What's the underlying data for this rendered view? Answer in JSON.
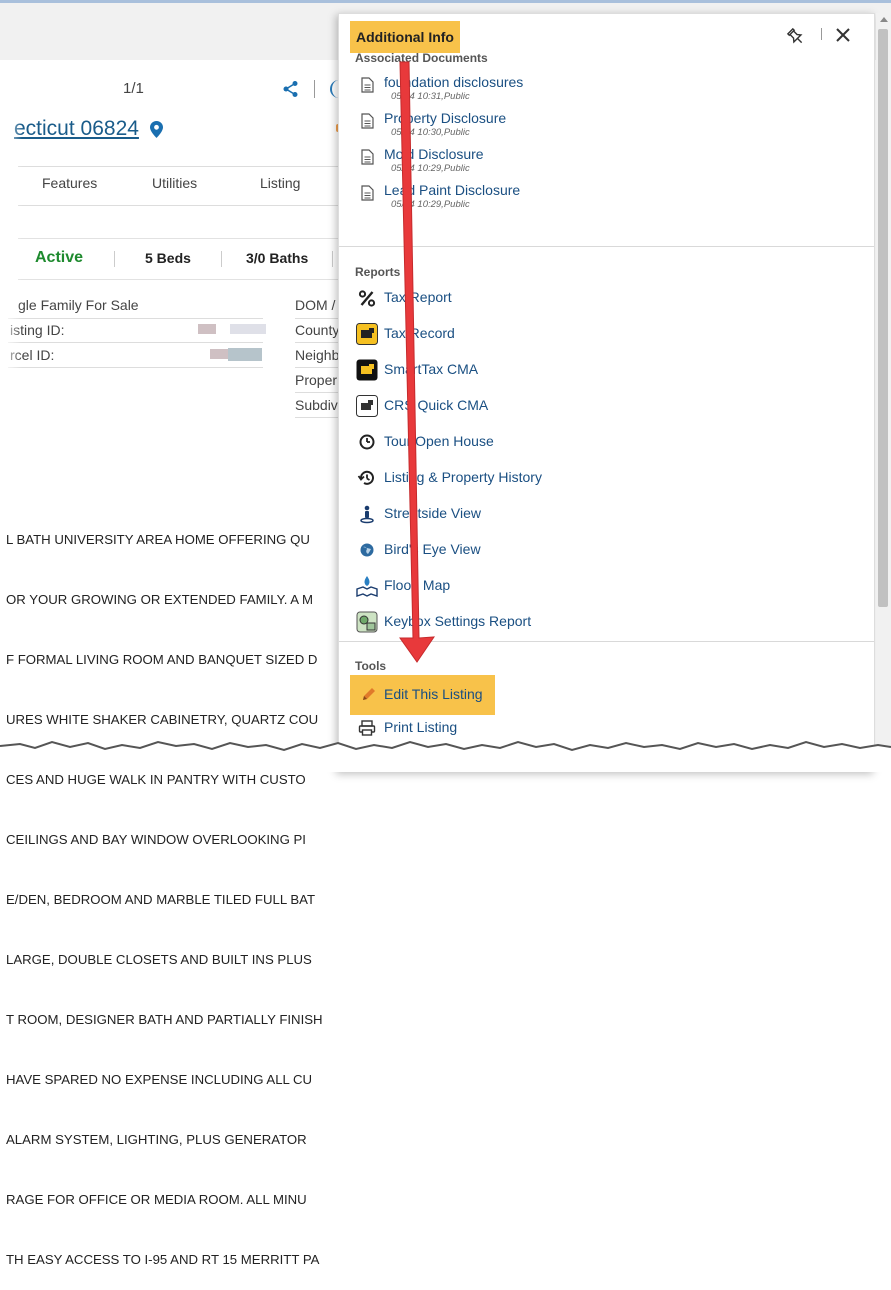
{
  "listing": {
    "page_count": "1/1",
    "address": "ecticut 06824",
    "tabs": [
      "Features",
      "Utilities",
      "Listing"
    ],
    "stats": {
      "status": "Active",
      "beds": "5 Beds",
      "baths": "3/0 Baths"
    },
    "left_details": [
      "gle Family For Sale",
      "isting ID:",
      "rcel ID:"
    ],
    "right_details": [
      "DOM /",
      "County",
      "Neighb",
      "Proper",
      "Subdiv"
    ],
    "description_lines": [
      "L BATH UNIVERSITY AREA HOME OFFERING QU",
      "OR YOUR GROWING OR EXTENDED FAMILY. A M",
      "F FORMAL LIVING ROOM AND BANQUET SIZED D",
      "URES WHITE SHAKER CABINETRY, QUARTZ COU",
      "CES AND HUGE WALK IN PANTRY WITH CUSTO",
      "CEILINGS AND BAY WINDOW OVERLOOKING PI",
      "E/DEN, BEDROOM AND MARBLE TILED FULL BAT",
      "LARGE, DOUBLE CLOSETS AND BUILT INS PLUS",
      "T ROOM, DESIGNER BATH AND PARTIALLY FINISH",
      "HAVE SPARED NO EXPENSE INCLUDING ALL CU",
      "ALARM SYSTEM, LIGHTING, PLUS GENERATOR",
      "RAGE FOR OFFICE OR MEDIA ROOM. ALL MINU",
      "TH EASY ACCESS TO I-95 AND RT 15 MERRITT PA"
    ]
  },
  "panel": {
    "title": "Additional Info",
    "sections": {
      "documents": "Associated Documents",
      "reports": "Reports",
      "tools": "Tools"
    },
    "documents": [
      {
        "label": "foundation disclosures",
        "meta": "05/24 10:31,Public"
      },
      {
        "label": "Property Disclosure",
        "meta": "05/24 10:30,Public"
      },
      {
        "label": "Mold Disclosure",
        "meta": "05/24 10:29,Public"
      },
      {
        "label": "Lead Paint Disclosure",
        "meta": "05/24 10:29,Public"
      }
    ],
    "reports": [
      {
        "label": "Tax Report",
        "icon": "percent-icon"
      },
      {
        "label": "Tax Record",
        "icon": "tax-record-icon"
      },
      {
        "label": "SmartTax CMA",
        "icon": "smarttax-icon"
      },
      {
        "label": "CRS Quick CMA",
        "icon": "crs-icon"
      },
      {
        "label": "Tour Open House",
        "icon": "clock-icon"
      },
      {
        "label": "Listing & Property History",
        "icon": "history-icon"
      },
      {
        "label": "Streetside View",
        "icon": "person-icon"
      },
      {
        "label": "Bird's Eye View",
        "icon": "globe-icon"
      },
      {
        "label": "Flood Map",
        "icon": "flood-map-icon"
      },
      {
        "label": "Keybox Settings Report",
        "icon": "keybox-icon"
      }
    ],
    "tools": [
      {
        "label": "Edit This Listing",
        "icon": "pencil-icon"
      },
      {
        "label": "Print Listing",
        "icon": "printer-icon"
      }
    ]
  },
  "colors": {
    "highlight": "#f8c24a",
    "link": "#1a4f82",
    "arrow": "#e8393b",
    "active": "#1e8a2e"
  }
}
